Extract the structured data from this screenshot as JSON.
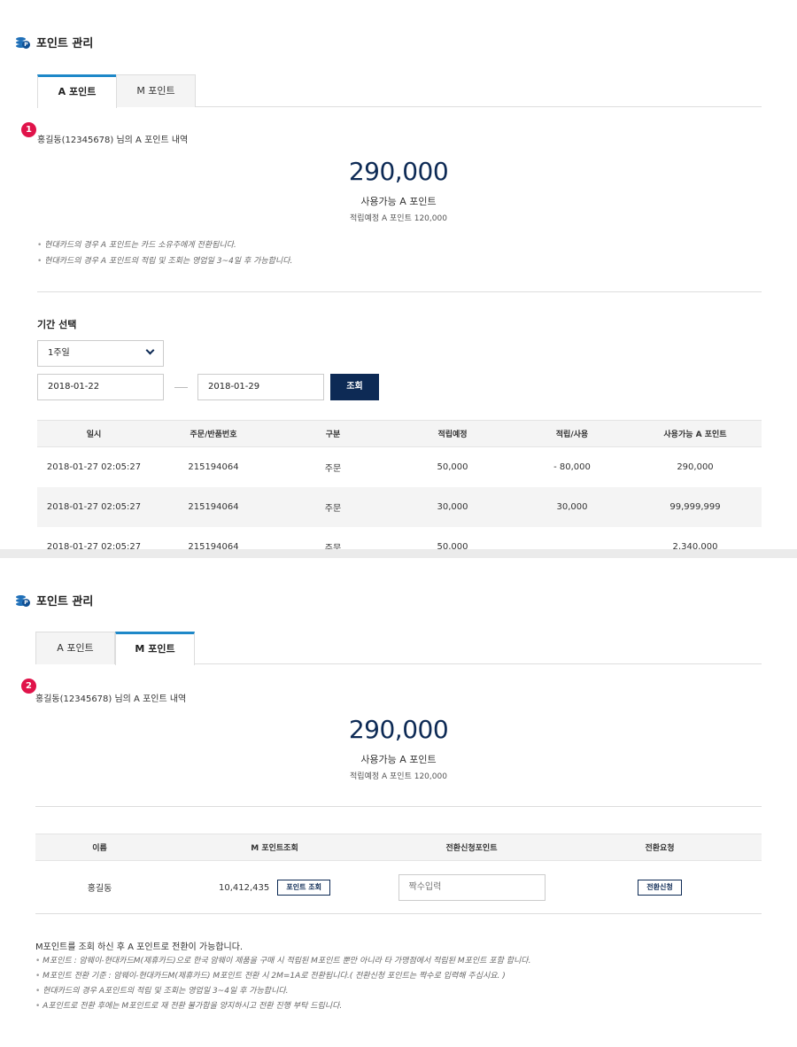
{
  "panel1": {
    "title": "포인트 관리",
    "tabs": [
      "A 포인트",
      "M 포인트"
    ],
    "badge": "1",
    "owner": "홍길동(12345678) 님의 A 포인트 내역",
    "points": "290,000",
    "available_label": "사용가능 A 포인트",
    "pending": "적립예정 A 포인트 120,000",
    "notes": [
      "현대카드의 경우 A 포인트는 카드 소유주에게 전환됩니다.",
      "현대카드의 경우 A 포인트의 적립 및 조회는 영업일 3~4일 후 가능합니다."
    ],
    "period_title": "기간 선택",
    "period_select": "1주일",
    "date_from": "2018-01-22",
    "date_to": "2018-01-29",
    "search_button": "조회",
    "columns": [
      "일시",
      "주문/반품번호",
      "구분",
      "적립예정",
      "적립/사용",
      "사용가능 A 포인트"
    ],
    "rows": [
      [
        "2018-01-27 02:05:27",
        "215194064",
        "주문",
        "50,000",
        "- 80,000",
        "290,000"
      ],
      [
        "2018-01-27 02:05:27",
        "215194064",
        "주문",
        "30,000",
        "30,000",
        "99,999,999"
      ],
      [
        "2018-01-27 02:05:27",
        "215194064",
        "주문",
        "50,000",
        "",
        "2,340,000"
      ]
    ]
  },
  "panel2": {
    "title": "포인트 관리",
    "tabs": [
      "A 포인트",
      "M 포인트"
    ],
    "badge": "2",
    "owner": "홍길동(12345678) 님의 A 포인트 내역",
    "points": "290,000",
    "available_label": "사용가능 A 포인트",
    "pending": "적립예정 A 포인트 120,000",
    "columns": [
      "이름",
      "M 포인트조회",
      "전환신청포인트",
      "전환요청"
    ],
    "row": {
      "name": "홍길동",
      "m_points": "10,412,435",
      "lookup_button": "포인트 조회",
      "input_placeholder": "짝수입력",
      "convert_button": "전환신청"
    },
    "guide_title": "M포인트를 조회 하신 후 A 포인트로 전환이 가능합니다.",
    "guide_notes": [
      "M포인트 : 암웨이-현대카드M(제휴카드)으로 한국 암웨이 제품을 구매 시 적립된 M포인트 뿐만 아니라 타 가맹점에서 적립된 M포인트 포함 합니다.",
      "M포인트 전환 기준 : 암웨이-현대카드M(제휴카드) M포인트 전환 시 2M=1A로 전환됩니다.( 전환신청 포인트는 짝수로 입력해 주십시요. )",
      "현대카드의 경우 A포인트의 적립 및 조회는 영업일 3~4일 후 가능합니다.",
      "A포인트로 전환 후에는 M포인트로 재 전환 불가함을 양지하시고 전환 진행 부탁 드립니다."
    ]
  },
  "colors": {
    "navy": "#0d2a55",
    "tab_accent": "#1e88c8",
    "badge": "#e0134a"
  }
}
